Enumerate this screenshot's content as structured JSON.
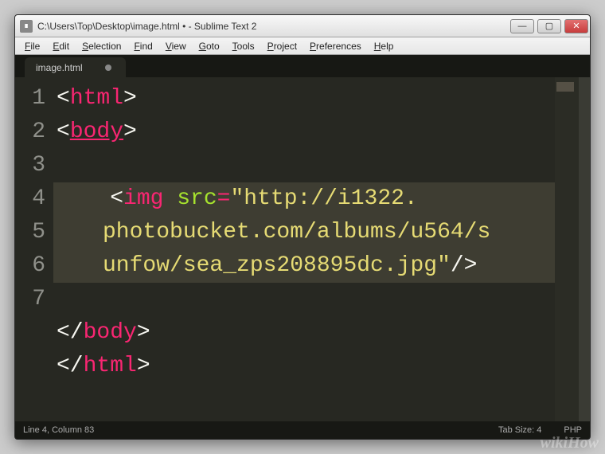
{
  "titlebar": {
    "title": "C:\\Users\\Top\\Desktop\\image.html • - Sublime Text 2"
  },
  "menu": [
    "File",
    "Edit",
    "Selection",
    "Find",
    "View",
    "Goto",
    "Tools",
    "Project",
    "Preferences",
    "Help"
  ],
  "tab": {
    "label": "image.html",
    "dirty": true
  },
  "gutter_lines": [
    "1",
    "2",
    "3",
    "4",
    " ",
    " ",
    "5",
    "6",
    "7"
  ],
  "code": {
    "l1_open": "<",
    "l1_tag": "html",
    "l1_close": ">",
    "l2_open": "<",
    "l2_tag": "body",
    "l2_close": ">",
    "l4_indent": "    ",
    "l4_open": "<",
    "l4_tag": "img",
    "l4_attr": " src",
    "l4_eq": "=",
    "l4_str1": "\"http://i1322.",
    "l4_str2": "photobucket.com/albums/u564/s",
    "l4_str3": "unfow/sea_zps208895dc.jpg\"",
    "l4_slashclose": "/>",
    "l6_open": "</",
    "l6_tag": "body",
    "l6_close": ">",
    "l7_open": "</",
    "l7_tag": "html",
    "l7_close": ">"
  },
  "status": {
    "left": "Line 4, Column 83",
    "tabsize": "Tab Size: 4",
    "syntax": "PHP"
  },
  "watermark": "wikiHow"
}
